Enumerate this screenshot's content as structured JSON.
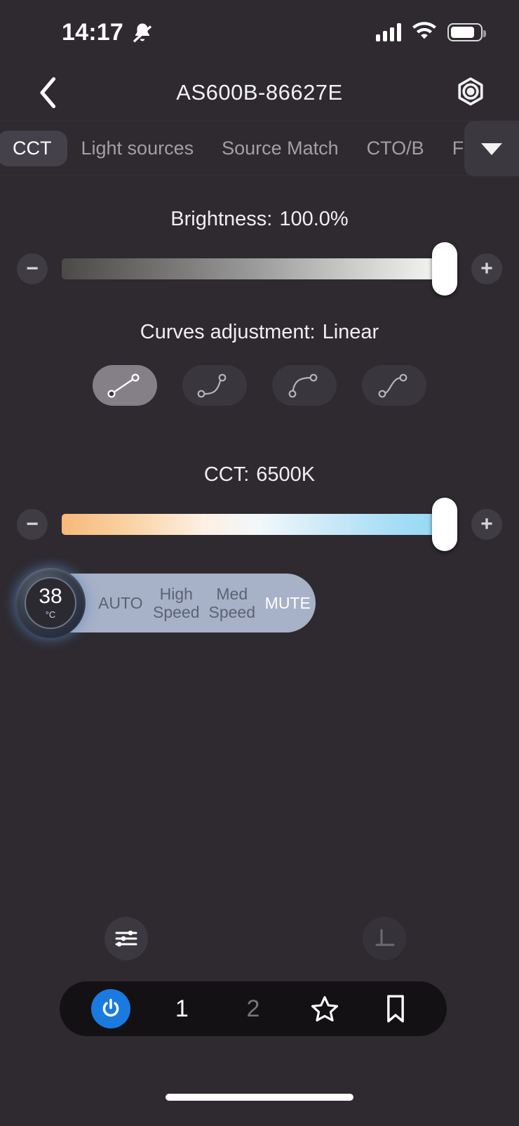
{
  "status_bar": {
    "time": "14:17",
    "silent_icon": "bell-slash-icon",
    "signal_icon": "cellular-signal-icon",
    "wifi_icon": "wifi-icon",
    "battery_icon": "battery-icon"
  },
  "header": {
    "back_icon": "chevron-left-icon",
    "title": "AS600B-86627E",
    "settings_icon": "hexagon-settings-icon"
  },
  "tabs": {
    "items": [
      {
        "label": "CCT",
        "active": true
      },
      {
        "label": "Light sources",
        "active": false
      },
      {
        "label": "Source Match",
        "active": false
      },
      {
        "label": "CTO/B",
        "active": false
      },
      {
        "label": "FX",
        "active": false
      }
    ],
    "more_icon": "chevron-down-icon"
  },
  "brightness": {
    "label": "Brightness:",
    "value": "100.0%",
    "percent": 100,
    "minus_label": "−",
    "plus_label": "+"
  },
  "curves": {
    "label": "Curves adjustment:",
    "value": "Linear",
    "options": [
      {
        "name": "linear",
        "selected": true
      },
      {
        "name": "ease-in",
        "selected": false
      },
      {
        "name": "ease-out",
        "selected": false
      },
      {
        "name": "ease-in-out",
        "selected": false
      }
    ]
  },
  "cct": {
    "label": "CCT:",
    "value": "6500K",
    "percent": 100,
    "minus_label": "−",
    "plus_label": "+"
  },
  "fan": {
    "temperature": "38",
    "temperature_unit": "°C",
    "options": [
      {
        "label": "AUTO",
        "selected": false
      },
      {
        "label": "High\nSpeed",
        "line1": "High",
        "line2": "Speed",
        "selected": false
      },
      {
        "label": "Med\nSpeed",
        "line1": "Med",
        "line2": "Speed",
        "selected": false
      },
      {
        "label": "MUTE",
        "selected": true
      }
    ],
    "pill_color": "#a7b1c7"
  },
  "tools": {
    "sliders_icon": "sliders-icon",
    "perpendicular_icon": "perpendicular-icon"
  },
  "bottom_nav": {
    "power_icon": "power-icon",
    "power_color": "#1a7ae0",
    "items": [
      {
        "label": "1",
        "active": true
      },
      {
        "label": "2",
        "active": false
      }
    ],
    "favorite_icon": "star-icon",
    "bookmark_icon": "bookmark-icon"
  },
  "home_indicator": "home-indicator"
}
